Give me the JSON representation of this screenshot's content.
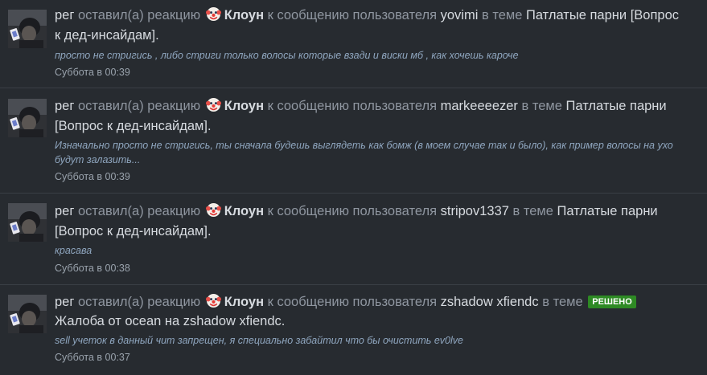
{
  "items": [
    {
      "user": "рег",
      "action": "оставил(а) реакцию",
      "reaction": "Клоун",
      "to_message": "к сообщению пользователя",
      "author": "yovimi",
      "in_thread": "в теме",
      "badge": "",
      "thread_line1": "Патлатые парни [Вопрос",
      "thread_line2": "к дед-инсайдам].",
      "quote_line1": "просто не стригись , либо стриги только волосы которые взади и виски мб , как хочешь кароче",
      "quote_line2": "",
      "date": "Суббота в 00:39"
    },
    {
      "user": "рег",
      "action": "оставил(а) реакцию",
      "reaction": "Клоун",
      "to_message": "к сообщению пользователя",
      "author": "markeeeezer",
      "in_thread": "в теме",
      "badge": "",
      "thread_line1": "Патлатые парни",
      "thread_line2": "[Вопрос к дед-инсайдам].",
      "quote_line1": "Изначально просто не стригись, ты сначала будешь выглядеть как бомж (в моем случае так и было), как пример волосы на ухо",
      "quote_line2": "будут залазить...",
      "date": "Суббота в 00:39"
    },
    {
      "user": "рег",
      "action": "оставил(а) реакцию",
      "reaction": "Клоун",
      "to_message": "к сообщению пользователя",
      "author": "stripov1337",
      "in_thread": "в теме",
      "badge": "",
      "thread_line1": "Патлатые парни",
      "thread_line2": "[Вопрос к дед-инсайдам].",
      "quote_line1": "красава",
      "quote_line2": "",
      "date": "Суббота в 00:38"
    },
    {
      "user": "рег",
      "action": "оставил(а) реакцию",
      "reaction": "Клоун",
      "to_message": "к сообщению пользователя",
      "author": "zshadow xfiendc",
      "in_thread": "в теме",
      "badge": "РЕШЕНО",
      "thread_line1": "",
      "thread_line2": "Жалоба от ocean на zshadow xfiendc.",
      "quote_line1": "sell учеток в данный чит запрещен, я специально забайтил что бы очистить ev0lve",
      "quote_line2": "",
      "date": "Суббота в 00:37"
    }
  ],
  "icons": {
    "reaction": "clown-face-icon",
    "avatar": "user-avatar-photo"
  },
  "colors": {
    "background": "#272b30",
    "separator": "#3a3f45",
    "muted_text": "#8f96a0",
    "link_text": "#d7dbe0",
    "quote_text": "#8fa6bf",
    "badge_bg": "#2e8a24"
  }
}
